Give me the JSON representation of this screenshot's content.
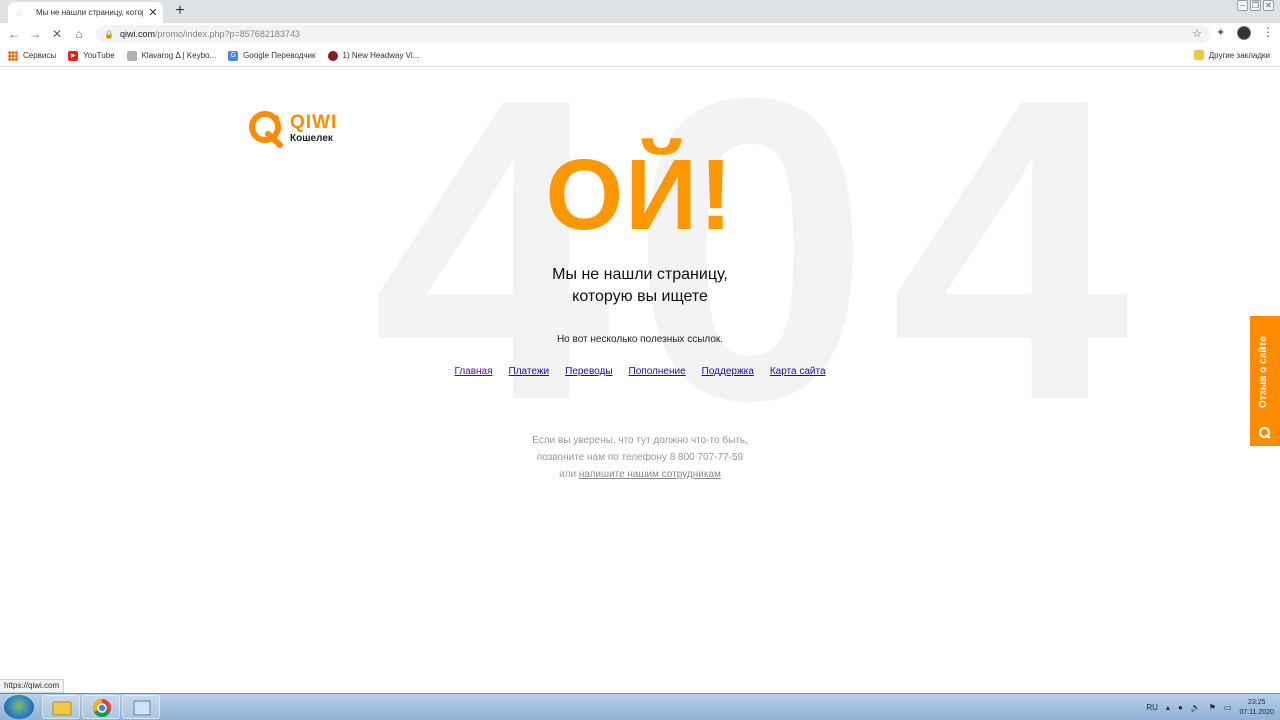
{
  "browser": {
    "tab_title": "Мы не нашли страницу, которую",
    "new_tab_symbol": "+",
    "url_host": "qiwi.com",
    "url_path": "/promo/index.php?p=857682183743",
    "bookmarks": [
      {
        "label": "Сервисы",
        "icon": "apps-grid-icon"
      },
      {
        "label": "YouTube",
        "icon": "youtube-icon"
      },
      {
        "label": "Klavarog Δ | Keybo...",
        "icon": "klavarog-icon"
      },
      {
        "label": "Google Переводчик",
        "icon": "google-translate-icon"
      },
      {
        "label": "1) New Headway Vi...",
        "icon": "headway-icon"
      }
    ],
    "other_bookmarks": "Другие закладки",
    "status_url": "https://qiwi.com"
  },
  "page": {
    "bg_code": "404",
    "logo_name": "QIWI",
    "logo_sub": "Кошелек",
    "oops": "ОЙ!",
    "headline_1": "Мы не нашли страницу,",
    "headline_2": "которую вы ищете",
    "useful_links_text": "Но вот несколько полезных ссылок.",
    "links": [
      "Главная",
      "Платежи",
      "Переводы",
      "Пополнение",
      "Поддержка",
      "Карта сайта"
    ],
    "contact_1": "Если вы уверены, что тут должно что-то быть,",
    "contact_2": "позвоните нам по телефону 8 800 707-77-59",
    "contact_3_prefix": "или ",
    "contact_3_link": "напишите нашим сотрудникам",
    "feedback_label": "Отзыв о сайте"
  },
  "colors": {
    "brand_orange": "#ff8c00",
    "oops_orange": "#ff9800",
    "link_blue": "#1a0dab",
    "link_visited": "#660099"
  },
  "taskbar": {
    "lang": "RU",
    "time": "23:25",
    "date": "07.11.2020"
  }
}
